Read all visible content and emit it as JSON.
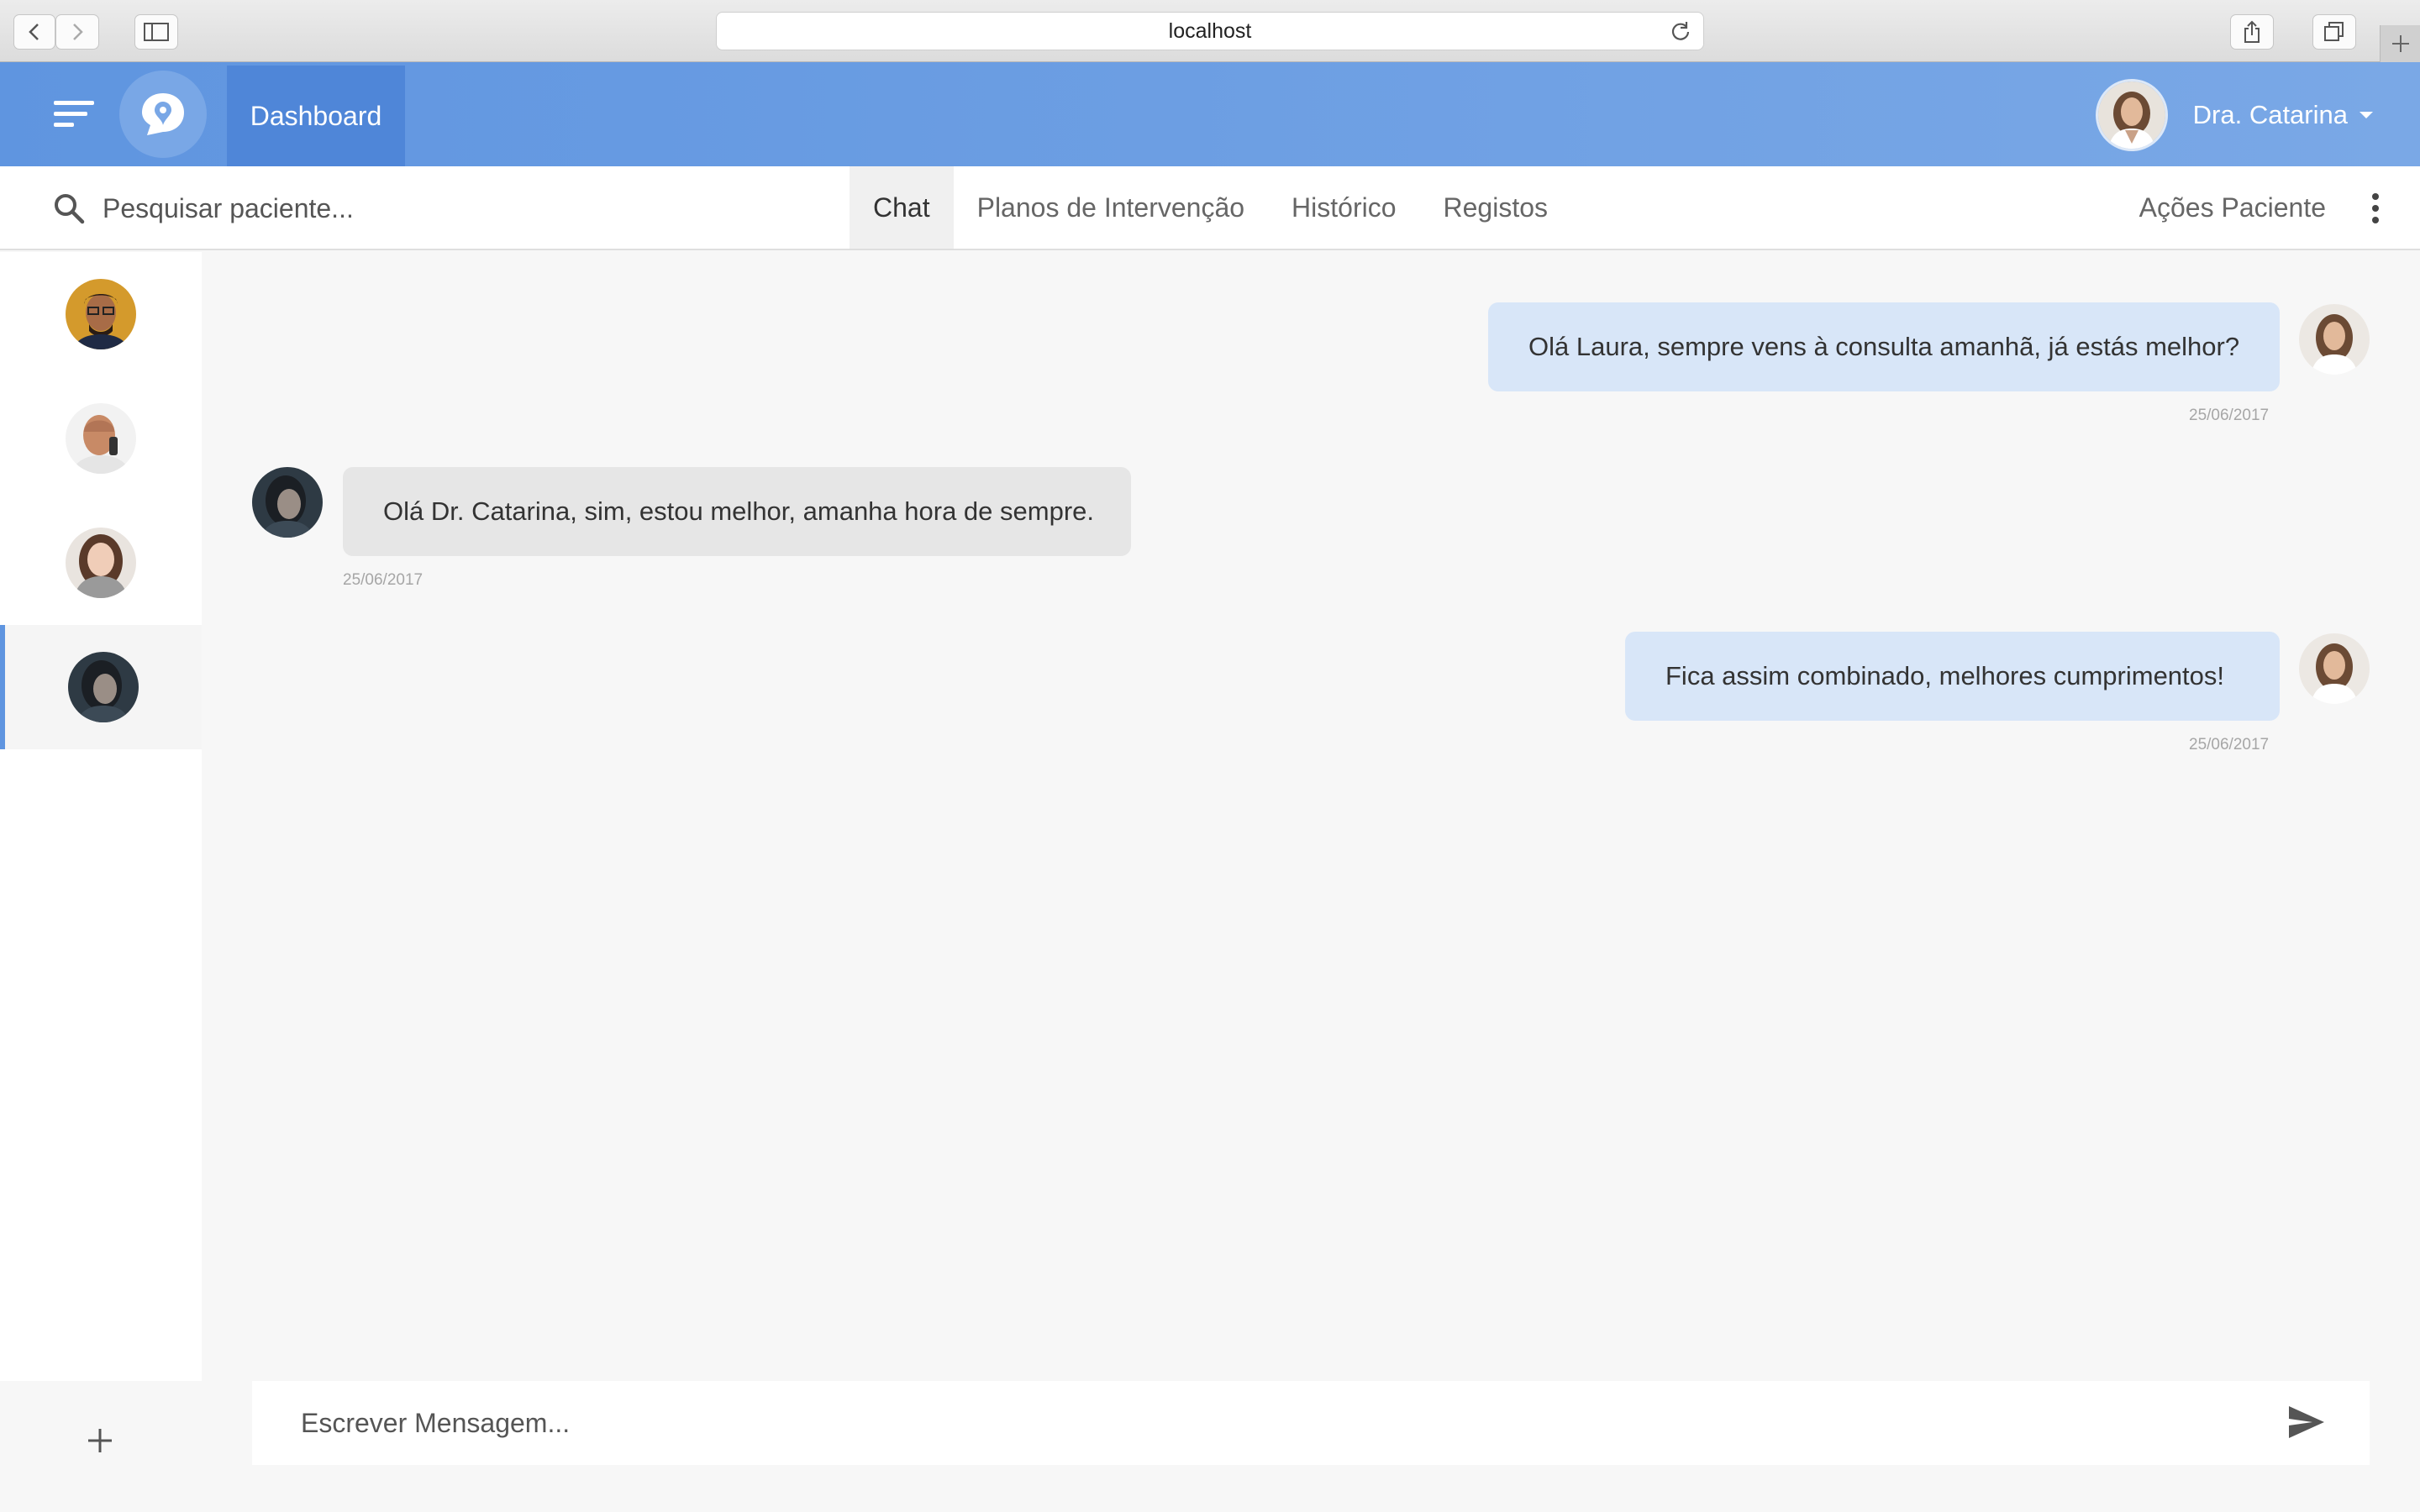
{
  "browser": {
    "url": "localhost"
  },
  "header": {
    "dashboard_label": "Dashboard",
    "user_name": "Dra. Catarina",
    "accent": "#5f95e0"
  },
  "toolbar": {
    "search_placeholder": "Pesquisar paciente...",
    "tabs": [
      {
        "label": "Chat",
        "active": true
      },
      {
        "label": "Planos de Intervenção",
        "active": false
      },
      {
        "label": "Histórico",
        "active": false
      },
      {
        "label": "Registos",
        "active": false
      }
    ],
    "actions_label": "Ações Paciente"
  },
  "sidebar": {
    "patients": [
      {
        "avatar": "man-glasses-avatar",
        "active": false
      },
      {
        "avatar": "man-phone-avatar",
        "active": false
      },
      {
        "avatar": "woman-scarf-avatar",
        "active": false
      },
      {
        "avatar": "woman-dark-avatar",
        "active": true
      }
    ],
    "add_icon": "plus-icon"
  },
  "chat": {
    "messages": [
      {
        "direction": "out",
        "text": "Olá Laura, sempre vens à consulta amanhã, já estás melhor?",
        "date": "25/06/2017"
      },
      {
        "direction": "in",
        "text": "Olá Dr. Catarina, sim, estou melhor, amanha hora de sempre.",
        "date": "25/06/2017"
      },
      {
        "direction": "out",
        "text": "Fica assim combinado, melhores cumprimentos!",
        "date": "25/06/2017"
      }
    ]
  },
  "composer": {
    "placeholder": "Escrever Mensagem...",
    "send_icon": "send-icon"
  }
}
